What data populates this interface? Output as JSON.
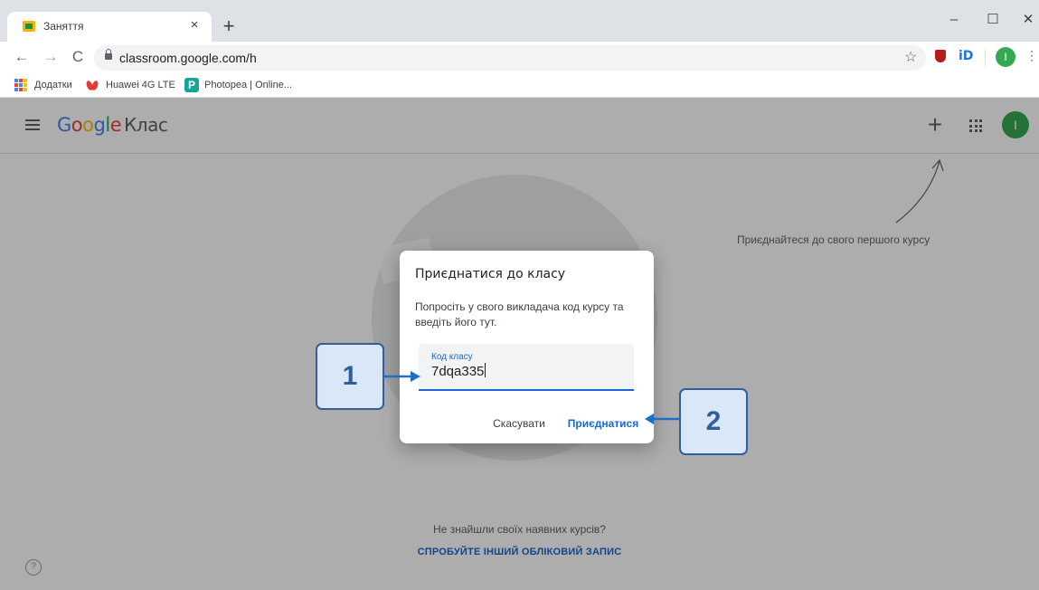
{
  "browser": {
    "tab_title": "Заняття",
    "tab_close": "×",
    "new_tab": "+",
    "window_controls": {
      "minimize": "–",
      "maximize": "☐",
      "close": "✕"
    },
    "nav": {
      "back": "←",
      "forward": "→",
      "reload": "C"
    },
    "url": "classroom.google.com/h",
    "star": "☆",
    "extension_id": "iD",
    "profile_initial": "I",
    "menu": "⋮"
  },
  "bookmarks": [
    {
      "label": "Додатки",
      "icon": "apps-grid-icon"
    },
    {
      "label": "Huawei 4G LTE",
      "icon": "huawei-icon"
    },
    {
      "label": "Photopea | Online...",
      "icon": "photopea-icon"
    }
  ],
  "photopea_glyph": "P",
  "app": {
    "logo": {
      "g1": "G",
      "o1": "o",
      "o2": "o",
      "g2": "g",
      "l": "l",
      "e": "e",
      "product": "Клас"
    },
    "plus": "+",
    "avatar_initial": "I",
    "hint": "Приєднайтеся до свого першого курсу",
    "empty_text": "Не знайшли своїх наявних курсів?",
    "switch_account": "СПРОБУЙТЕ ІНШИЙ ОБЛІКОВИЙ ЗАПИС",
    "help": "?"
  },
  "dialog": {
    "title": "Приєднатися до класу",
    "description": "Попросіть у свого викладача код курсу та введіть його тут.",
    "field_label": "Код класу",
    "field_value": "7dqa335",
    "cancel": "Скасувати",
    "join": "Приєднатися"
  },
  "callouts": {
    "one": "1",
    "two": "2"
  },
  "colors": {
    "accent": "#1967d2",
    "callout_fill": "#dae7f7",
    "callout_border": "#2f5f9d",
    "avatar": "#34a853"
  }
}
